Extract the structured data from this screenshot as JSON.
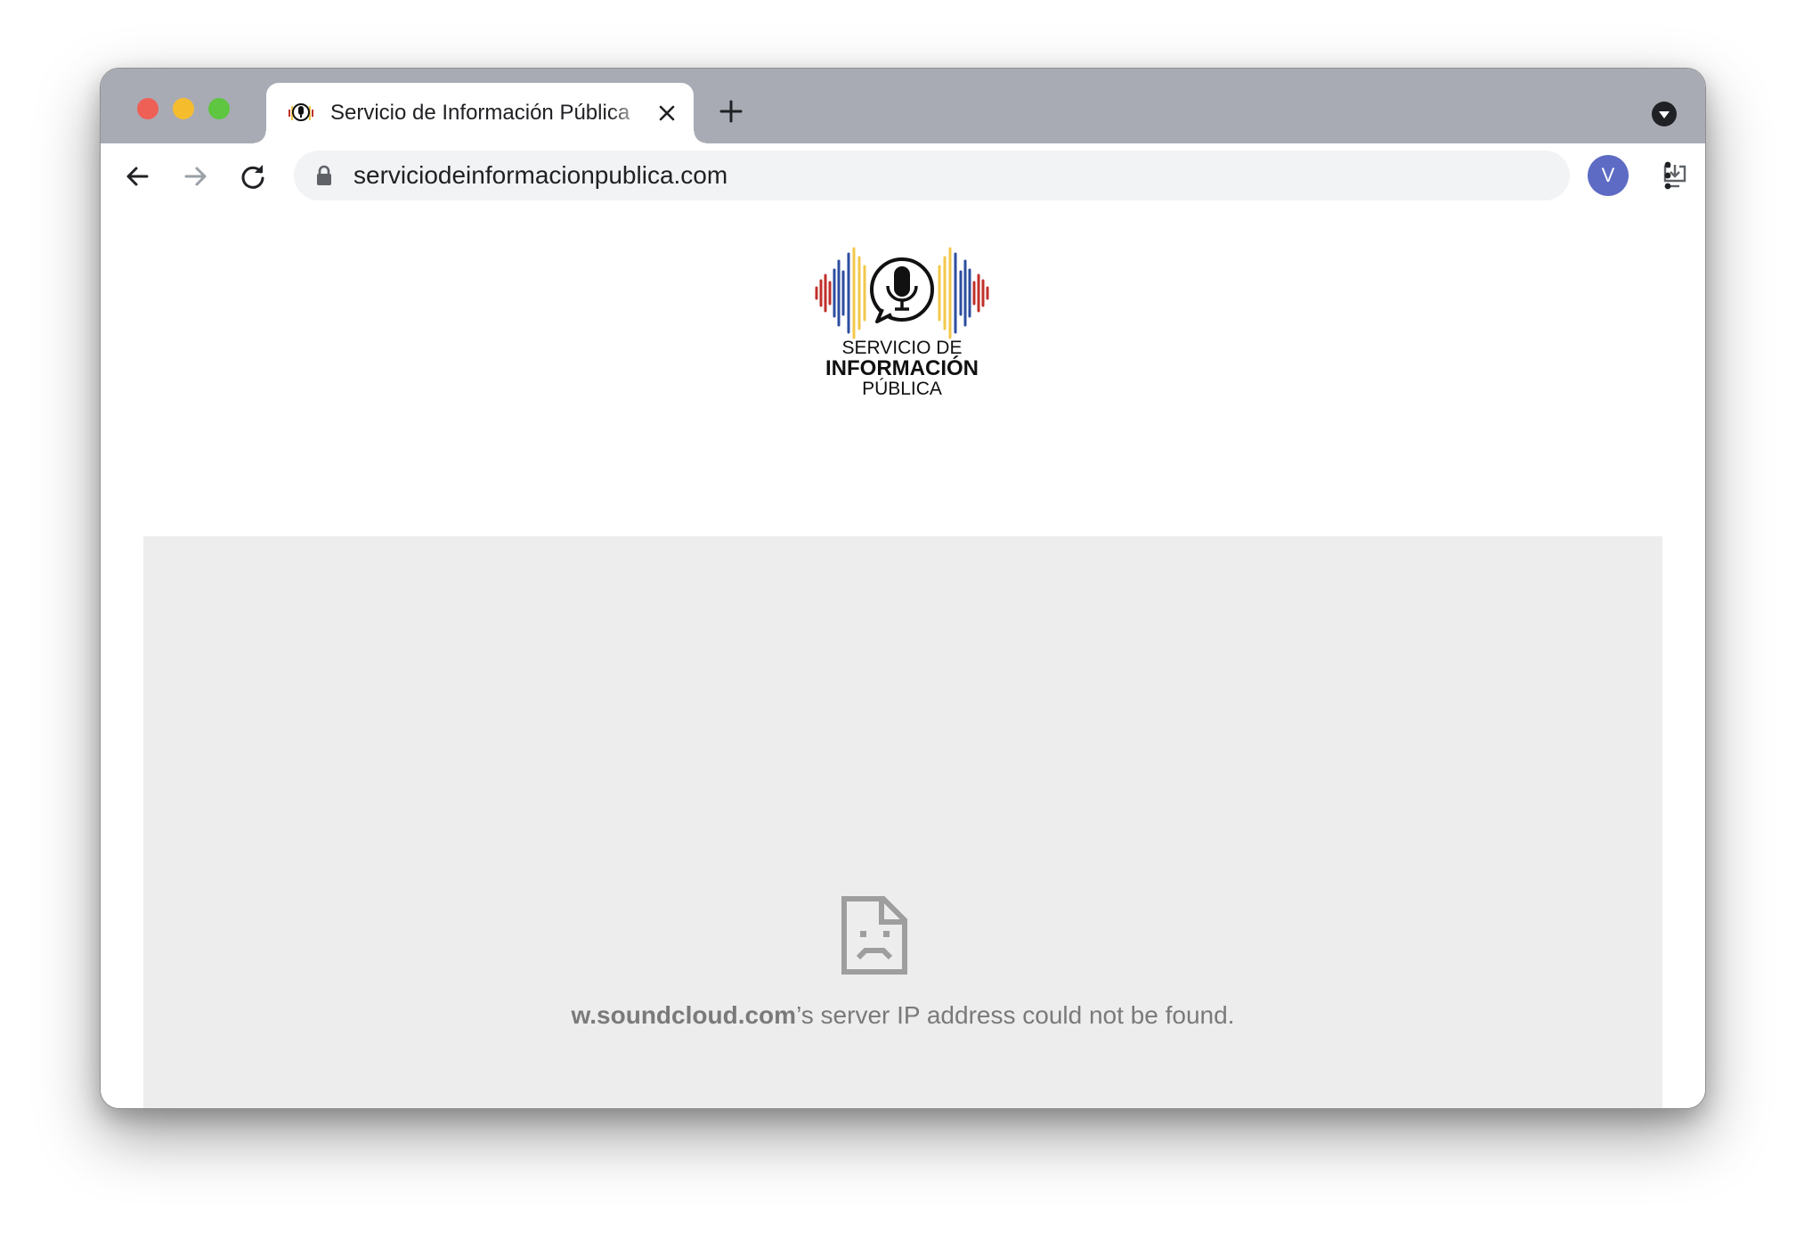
{
  "browser": {
    "tab": {
      "title": "Servicio de Información Pública"
    },
    "address_bar": {
      "url": "serviciodeinformacionpublica.com"
    },
    "profile": {
      "initial": "V",
      "color": "#5d6bc4"
    }
  },
  "page": {
    "logo": {
      "line1": "SERVICIO DE",
      "line2": "INFORMACIÓN",
      "line3": "PÚBLICA",
      "colors": [
        "#c0302b",
        "#2c4ea0",
        "#f2c84b"
      ]
    },
    "embed_error": {
      "icon": "sad-document-icon",
      "host": "w.soundcloud.com",
      "message": "’s server IP address could not be found."
    }
  }
}
